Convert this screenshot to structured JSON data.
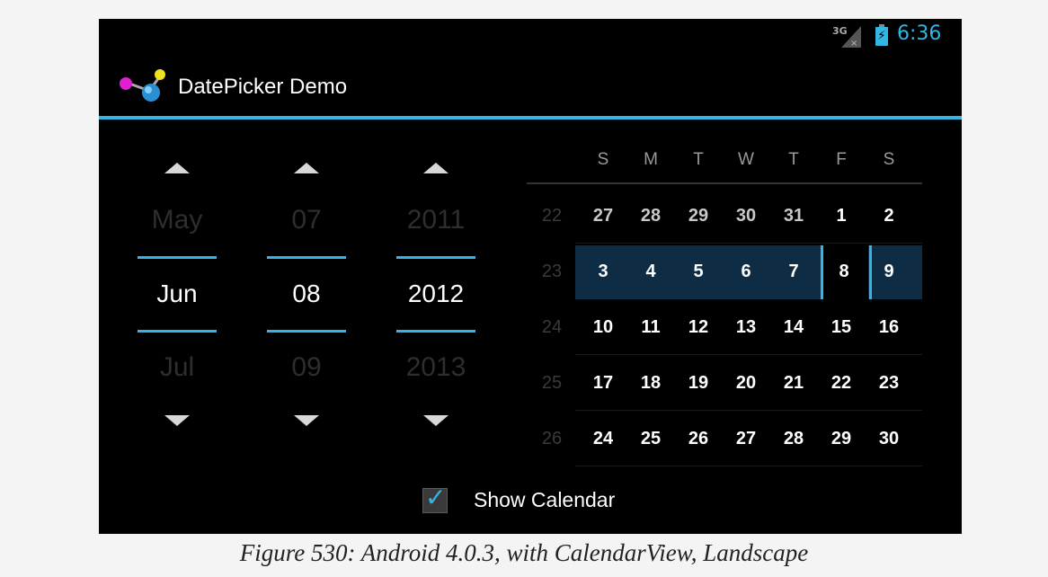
{
  "status_bar": {
    "network": "3G",
    "time": "6:36"
  },
  "action_bar": {
    "title": "DatePicker Demo"
  },
  "date_picker": {
    "month": {
      "prev": "May",
      "current": "Jun",
      "next": "Jul"
    },
    "day": {
      "prev": "07",
      "current": "08",
      "next": "09"
    },
    "year": {
      "prev": "2011",
      "current": "2012",
      "next": "2013"
    }
  },
  "calendar": {
    "weekday_headers": [
      "S",
      "M",
      "T",
      "W",
      "T",
      "F",
      "S"
    ],
    "weeks": [
      {
        "num": "22",
        "days": [
          "27",
          "28",
          "29",
          "30",
          "31",
          "1",
          "2"
        ],
        "other_month": [
          true,
          true,
          true,
          true,
          true,
          false,
          false
        ]
      },
      {
        "num": "23",
        "days": [
          "3",
          "4",
          "5",
          "6",
          "7",
          "8",
          "9"
        ],
        "other_month": [
          false,
          false,
          false,
          false,
          false,
          false,
          false
        ]
      },
      {
        "num": "24",
        "days": [
          "10",
          "11",
          "12",
          "13",
          "14",
          "15",
          "16"
        ],
        "other_month": [
          false,
          false,
          false,
          false,
          false,
          false,
          false
        ]
      },
      {
        "num": "25",
        "days": [
          "17",
          "18",
          "19",
          "20",
          "21",
          "22",
          "23"
        ],
        "other_month": [
          false,
          false,
          false,
          false,
          false,
          false,
          false
        ]
      },
      {
        "num": "26",
        "days": [
          "24",
          "25",
          "26",
          "27",
          "28",
          "29",
          "30"
        ],
        "other_month": [
          false,
          false,
          false,
          false,
          false,
          false,
          false
        ]
      }
    ]
  },
  "show_calendar": {
    "label": "Show Calendar",
    "checked": true
  },
  "caption": "Figure 530: Android 4.0.3, with CalendarView, Landscape",
  "colors": {
    "accent": "#33b5e5",
    "selected_week_bg": "#0e2d45",
    "background": "#000000"
  }
}
